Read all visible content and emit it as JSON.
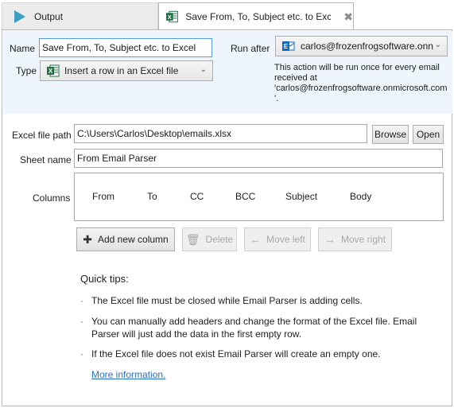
{
  "tabs": [
    {
      "label": "Output",
      "icon": "play-icon",
      "active": false
    },
    {
      "label": "Save From, To, Subject etc. to Exce",
      "icon": "excel-icon",
      "active": true
    }
  ],
  "header": {
    "name_label": "Name",
    "name_value": "Save From, To, Subject etc. to Excel",
    "type_label": "Type",
    "type_value": "Insert a row in an Excel file",
    "run_after_label": "Run after",
    "run_after_value": "carlos@frozenfrogsoftware.onn",
    "hint_line1": "This action will be run once for every email",
    "hint_line2": "received at",
    "hint_line3": "'carlos@frozenfrogsoftware.onmicrosoft.com",
    "hint_line4": "'."
  },
  "form": {
    "file_path_label": "Excel file path",
    "file_path_value": "C:\\Users\\Carlos\\Desktop\\emails.xlsx",
    "browse_label": "Browse",
    "open_label": "Open",
    "sheet_label": "Sheet name",
    "sheet_value": "From Email Parser",
    "columns_label": "Columns",
    "columns": [
      "From",
      "To",
      "CC",
      "BCC",
      "Subject",
      "Body"
    ]
  },
  "actions": {
    "add": "Add new column",
    "delete": "Delete",
    "move_left": "Move left",
    "move_right": "Move right"
  },
  "tips": {
    "title": "Quick tips:",
    "items": [
      "The Excel file must be closed while Email Parser is adding cells.",
      "You can manually add headers and change the format of the Excel file. Email Parser will just add the data in the first empty row.",
      "If the Excel file does not exist Email Parser will create an empty one."
    ],
    "more_info": "More information."
  },
  "colors": {
    "header_bg": "#eef5fc",
    "excel_green": "#1d7044",
    "outlook_blue": "#0f6ac3",
    "link": "#2a6fc9",
    "play_icon": "#3c9ec2"
  }
}
